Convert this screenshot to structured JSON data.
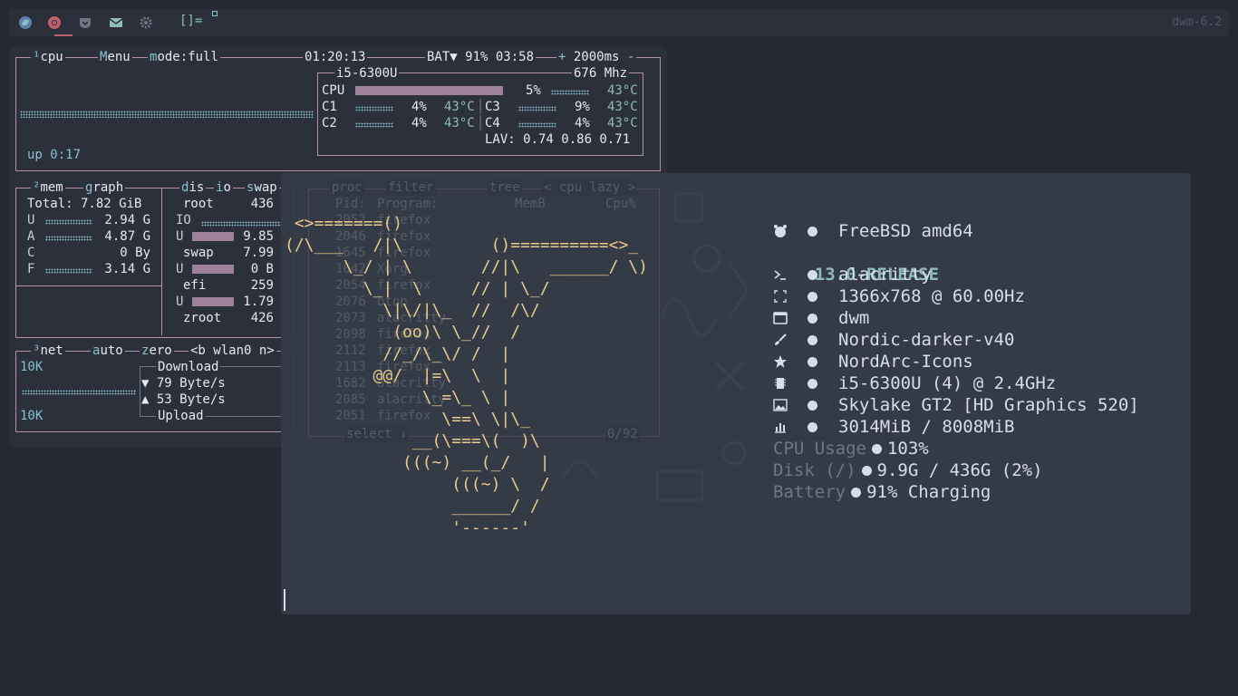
{
  "topbar": {
    "icons": [
      "firefox-icon",
      "chrome-icon",
      "pocket-icon",
      "mail-icon",
      "settings-icon"
    ],
    "layout_symbol": "[]=",
    "wm_version": "dwm-6.2"
  },
  "btop": {
    "cpu_box": {
      "num": "¹",
      "title": "cpu",
      "menu": "Menu",
      "mode": "mode:full",
      "clock": "01:20:13",
      "battery": "BAT▼ 91% 03:58",
      "plus": "+",
      "interval": "2000ms",
      "minus": "-",
      "uptime": "up 0:17",
      "cpu_model": "i5-6300U",
      "freq": "676 Mhz",
      "cpu_label": "CPU",
      "cpu_pct": "5%",
      "cpu_temp": "43°C",
      "cores": [
        {
          "name": "C1",
          "pct": "4%",
          "temp": "43°C"
        },
        {
          "name": "C2",
          "pct": "4%",
          "temp": "43°C"
        },
        {
          "name": "C3",
          "pct": "9%",
          "temp": "43°C"
        },
        {
          "name": "C4",
          "pct": "4%",
          "temp": "43°C"
        }
      ],
      "lav": "LAV: 0.74 0.86 0.71"
    },
    "mem_box": {
      "num": "²",
      "title": "mem",
      "graph": "graph",
      "total": "Total: 7.82 GiB",
      "rows": [
        {
          "k": "U",
          "v": "2.94 G"
        },
        {
          "k": "A",
          "v": "4.87 G"
        },
        {
          "k": "C",
          "v": "0 By"
        },
        {
          "k": "F",
          "v": "3.14 G"
        }
      ]
    },
    "disks_box": {
      "title_d": "d",
      "title_rest": "is",
      "io": "io",
      "swap": "swap",
      "rows": [
        {
          "k": "root",
          "v": "436"
        },
        {
          "k": "IO",
          "v": ""
        },
        {
          "k": "U",
          "v": "9.85"
        },
        {
          "k": "swap",
          "v": "7.99"
        },
        {
          "k": "U",
          "v": "0 B"
        },
        {
          "k": "efi",
          "v": "259"
        },
        {
          "k": "U",
          "v": "1.79"
        },
        {
          "k": "zroot",
          "v": "426"
        }
      ]
    },
    "net_box": {
      "num": "³",
      "title": "net",
      "auto": "auto",
      "zero": "zero",
      "iface": "<b wlan0 n>",
      "top_scale": "10K",
      "bottom_scale": "10K",
      "download_label": "Download",
      "download_rate": "▼ 79 Byte/s",
      "upload_rate": "▲ 53 Byte/s",
      "upload_label": "Upload"
    },
    "proc_box": {
      "title": "proc",
      "filter": "filter",
      "tree": "tree",
      "lazy": "< cpu lazy >",
      "select": "select ↓",
      "count": "0/92",
      "columns": [
        "Pid:",
        "Program:",
        "MemB",
        "Cpu%"
      ],
      "rows": [
        [
          "2052",
          "firefox"
        ],
        [
          "2046",
          "firefox"
        ],
        [
          "1645",
          "firefox"
        ],
        [
          "1642",
          "Xorg"
        ],
        [
          "2054",
          "firefox"
        ],
        [
          "2076",
          "btop"
        ],
        [
          "2073",
          "alacritty"
        ],
        [
          "2098",
          "firefox"
        ],
        [
          "2112",
          "firefox"
        ],
        [
          "2113",
          "firefox"
        ],
        [
          "1682",
          "alacritty"
        ],
        [
          "2085",
          "alacritty"
        ],
        [
          "2051",
          "firefox"
        ]
      ]
    }
  },
  "fetch": {
    "ascii": [
      " <>=======()",
      "(/\\___   /|\\         ()==========<>_",
      "      \\_/ | \\       //|\\   ______/ \\)",
      "        \\_|  \\     // | \\_/",
      "          \\|\\/|\\_  //  /\\/",
      "           (oo)\\ \\_//  /",
      "          //_/\\_\\/ /  |",
      "         @@/  |=\\  \\  |",
      "              \\_=\\_ \\ |",
      "                \\==\\ \\|\\_",
      "             __(\\===\\(  )\\",
      "            (((~) __(_/   |",
      "                 (((~) \\  /",
      "                 ______/ /",
      "                 '------'"
    ],
    "os": "FreeBSD amd64",
    "release": "13.0-RELEASE",
    "rows": [
      {
        "icon": "terminal-icon",
        "value": "alacritty"
      },
      {
        "icon": "resolution-icon",
        "value": "1366x768 @ 60.00Hz"
      },
      {
        "icon": "window-icon",
        "value": "dwm"
      },
      {
        "icon": "brush-icon",
        "value": "Nordic-darker-v40"
      },
      {
        "icon": "star-icon",
        "value": "NordArc-Icons"
      },
      {
        "icon": "chip-icon",
        "value": "i5-6300U (4) @ 2.4GHz"
      },
      {
        "icon": "image-icon",
        "value": "Skylake GT2 [HD Graphics 520]"
      },
      {
        "icon": "chart-icon",
        "value": "3014MiB / 8008MiB"
      }
    ],
    "cpu_usage_label": "CPU Usage",
    "cpu_usage_value": "103%",
    "disk_label": "Disk (/)",
    "disk_value": "9.9G / 436G (2%)",
    "battery_label": "Battery",
    "battery_value": "91% Charging"
  },
  "colors": {
    "accent_cyan": "#88c0d0",
    "frame_purple": "#b48ead",
    "ascii_yellow": "#ebcb8b",
    "terminal_bg": "#353b47"
  }
}
